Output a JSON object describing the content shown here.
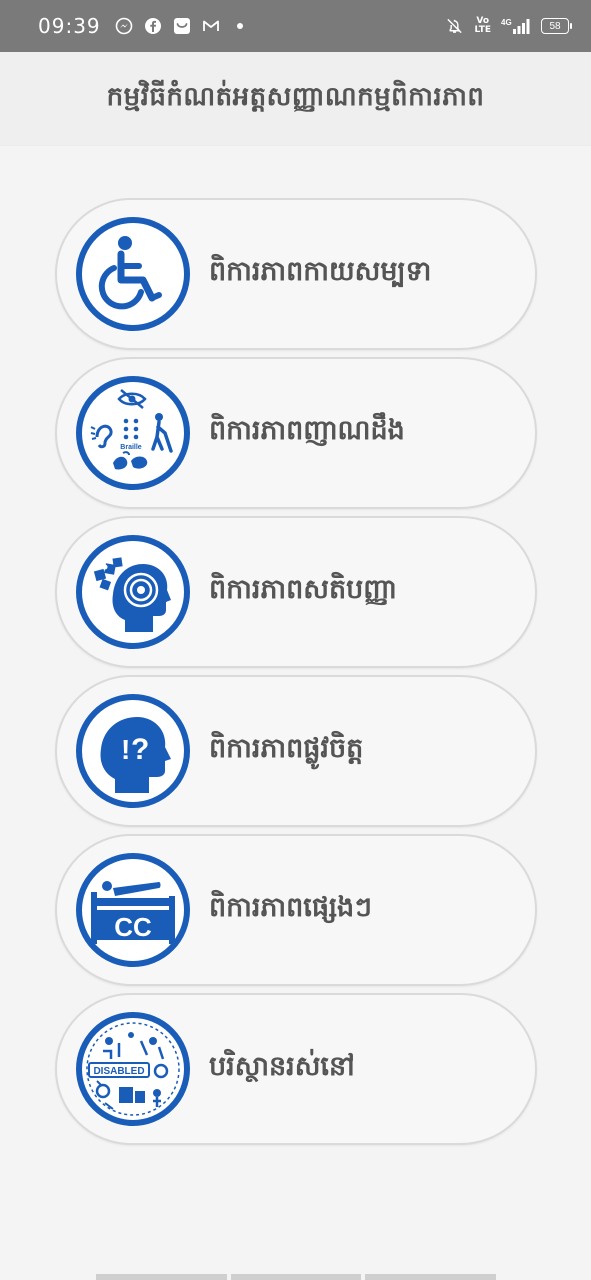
{
  "status_bar": {
    "time": "09:39",
    "left_icons": [
      "messenger-icon",
      "facebook-icon",
      "inbox-icon",
      "gmail-icon",
      "dot-icon"
    ],
    "right_icons": [
      "mute-icon",
      "volte-icon",
      "4g-signal-icon"
    ],
    "volte_text": "Vo\nLTE",
    "network": "4G",
    "battery": "58"
  },
  "header": {
    "title": "កម្មវិធីកំណត់អត្តសញ្ញាណកម្មពិការភាព"
  },
  "menu": {
    "items": [
      {
        "label": "ពិការភាពកាយសម្បទា",
        "icon": "wheelchair-icon"
      },
      {
        "label": "ពិការភាពញាណដឹង",
        "icon": "sensory-impairment-icon"
      },
      {
        "label": "ពិការភាពសតិបញ្ញា",
        "icon": "puzzle-head-icon"
      },
      {
        "label": "ពិការភាពផ្លូវចិត្ត",
        "icon": "question-head-icon"
      },
      {
        "label": "ពិការភាពផ្សេងៗ",
        "icon": "bed-cc-icon"
      },
      {
        "label": "បរិស្ថានរស់នៅ",
        "icon": "disabled-environment-icon"
      }
    ],
    "icon_labels": {
      "braille": "Braille",
      "cc": "CC",
      "disabled": "DISABLED"
    }
  },
  "colors": {
    "icon_blue": "#1a5db8",
    "status_bar_bg": "#7a7a7a",
    "header_bg": "#efefef",
    "page_bg": "#f4f4f4",
    "text": "#555555"
  }
}
